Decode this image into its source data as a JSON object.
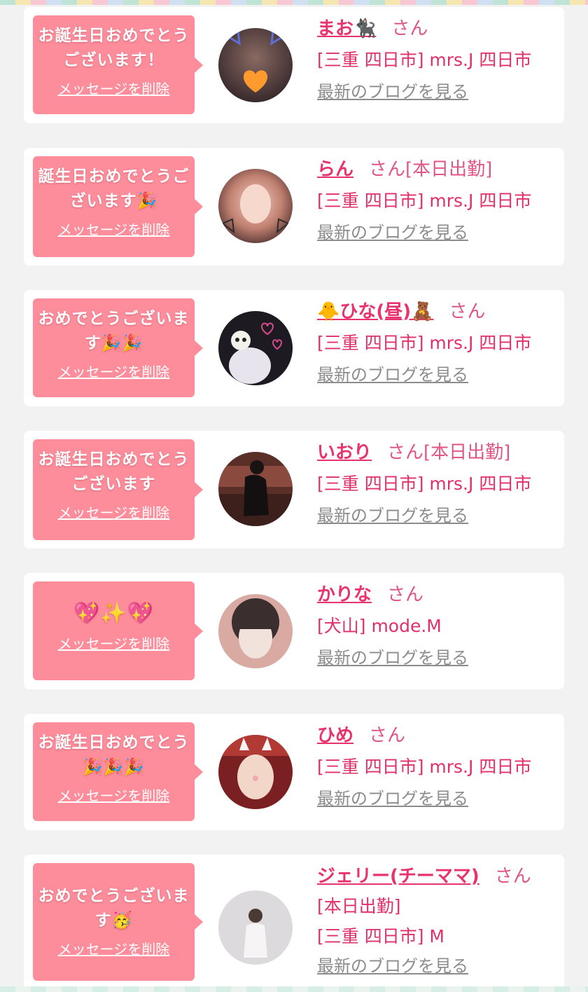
{
  "delete_label": "メッセージを削除",
  "blog_label": "最新のブログを見る",
  "san": "さん",
  "colors": {
    "bubble": "#fe8d9c",
    "name": "#e8336e",
    "shop": "#e0306a",
    "blog": "#8c8c8c",
    "background": "#f2f2f2"
  },
  "cards": [
    {
      "message": "お誕生日おめでとうございます！",
      "name": "まお🐈‍⬛",
      "status": "",
      "shop": "[三重 四日市] mrs.J 四日市"
    },
    {
      "message": "誕生日おめでとうございます🎉",
      "name": "らん",
      "status": "[本日出勤]",
      "shop": "[三重 四日市] mrs.J 四日市"
    },
    {
      "message": "おめでとうございます🎉🎉",
      "name": "🐥ひな(昼)🧸",
      "status": "",
      "shop": "[三重 四日市] mrs.J 四日市"
    },
    {
      "message": "お誕生日おめでとうございます",
      "name": "いおり",
      "status": "[本日出勤]",
      "shop": "[三重 四日市] mrs.J 四日市"
    },
    {
      "message": "💖✨💖",
      "name": "かりな",
      "status": "",
      "shop": "[犬山] mode.M"
    },
    {
      "message": "お誕生日おめでとう🎉🎉🎉",
      "name": "ひめ",
      "status": "",
      "shop": "[三重 四日市] mrs.J 四日市"
    },
    {
      "message": "おめでとうございます🥳",
      "name": "ジェリー(チーママ)",
      "status": "[本日出勤]",
      "shop": "[三重 四日市] M"
    }
  ]
}
